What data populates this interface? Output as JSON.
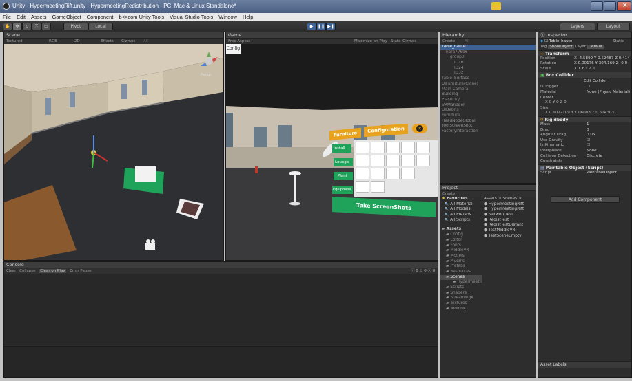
{
  "window": {
    "title": "Unity - HypermeetingRift.unity - HypermeetingRedistribution - PC, Mac & Linux Standalone*"
  },
  "menu": [
    "File",
    "Edit",
    "Assets",
    "GameObject",
    "Component",
    "b<>com Unity Tools",
    "Visual Studio Tools",
    "Window",
    "Help"
  ],
  "toolbar": {
    "pivot": "Pivot",
    "local": "Local",
    "layers": "Layers",
    "layout": "Layout"
  },
  "scene": {
    "tab": "Scene",
    "mode": "Textured",
    "color": "RGB",
    "dim": "2D",
    "effects": "Effects",
    "gizmos": "Gizmos",
    "search": "All",
    "persp": "Persp"
  },
  "game": {
    "tab": "Game",
    "aspect": "Free Aspect",
    "maximize": "Maximize on Play",
    "stats": "Stats",
    "gizmos": "Gizmos",
    "config_btn": "Config"
  },
  "vr_menu": {
    "header_left": "Furniture",
    "header_config": "Configuration",
    "categories": [
      "Install",
      "Lounge",
      "Plant",
      "Equipment"
    ],
    "screenshot_btn": "Take ScreenShots"
  },
  "hierarchy": {
    "tab": "Hierarchy",
    "create": "Create",
    "search": "All",
    "items": [
      {
        "label": "Table_haute",
        "indent": 0,
        "selected": true
      },
      {
        "label": "hara77696",
        "indent": 1
      },
      {
        "label": "group0",
        "indent": 2
      },
      {
        "label": "ID16",
        "indent": 3
      },
      {
        "label": "ID24",
        "indent": 3
      },
      {
        "label": "ID32",
        "indent": 3
      },
      {
        "label": "Table_Surface",
        "indent": 0
      },
      {
        "label": "UIFurniture(Clone)",
        "indent": 0
      },
      {
        "label": "Main Camera",
        "indent": 0
      },
      {
        "label": "Building",
        "indent": 0
      },
      {
        "label": "Plasticity",
        "indent": 0
      },
      {
        "label": "VRManager",
        "indent": 0
      },
      {
        "label": "UIDebris",
        "indent": 0
      },
      {
        "label": "Furniture",
        "indent": 0
      },
      {
        "label": "HeadNodeGlobal",
        "indent": 0
      },
      {
        "label": "ToolScreenShot",
        "indent": 0
      },
      {
        "label": "FactoryInteraction",
        "indent": 0
      }
    ]
  },
  "inspector": {
    "tab": "Inspector",
    "object_name": "Table_haute",
    "static": "Static",
    "tag_label": "Tag",
    "tag": "ShowObject",
    "layer_label": "Layer",
    "layer": "Default",
    "transform": {
      "title": "Transform",
      "position_label": "Position",
      "position": "X -4.5899  Y 0.52487  Z 0.414",
      "rotation_label": "Rotation",
      "rotation": "X 0.00176  Y 304.169  Z -0.0",
      "scale_label": "Scale",
      "scale": "X 1        Y 1        Z 1"
    },
    "box_collider": {
      "title": "Box Collider",
      "edit": "Edit Collider",
      "is_trigger_label": "Is Trigger",
      "material_label": "Material",
      "material": "None (Physic Material)",
      "center_label": "Center",
      "center": "X 0         Y 0         Z 0",
      "size_label": "Size",
      "size": "X 0.6072109  Y 1.06083  Z 0.614303"
    },
    "rigidbody": {
      "title": "Rigidbody",
      "mass_label": "Mass",
      "mass": "1",
      "drag_label": "Drag",
      "drag": "0",
      "angular_drag_label": "Angular Drag",
      "angular_drag": "0.05",
      "use_gravity_label": "Use Gravity",
      "is_kinematic_label": "Is Kinematic",
      "interpolate_label": "Interpolate",
      "interpolate": "None",
      "collision_label": "Collision Detection",
      "collision": "Discrete",
      "constraints_label": "Constraints"
    },
    "paintable": {
      "title": "Paintable Object (Script)",
      "script_label": "Script",
      "script": "PaintableObject"
    },
    "add_component": "Add Component",
    "asset_labels": "Asset Labels"
  },
  "project": {
    "tab": "Project",
    "create": "Create",
    "favorites_header": "Favorites",
    "favorites": [
      "All Material",
      "All Models",
      "All Prefabs",
      "All Scripts"
    ],
    "assets_header": "Assets",
    "folders": [
      "Config",
      "Editor",
      "Fonts",
      "MiddleVR",
      "Models",
      "Plugins",
      "Prefabs",
      "Resources",
      "Scenes",
      "Hypermeeting",
      "Scripts",
      "Shaders",
      "StreamingA",
      "Textures",
      "Toolbox"
    ],
    "breadcrumb": "Assets > Scenes >",
    "files": [
      "HypermeetingRift",
      "HypermeetingRift",
      "NetworkTest",
      "RedistTest",
      "RedistTestDistant",
      "TestMiddleVR",
      "TestSceneEmpty"
    ]
  },
  "console": {
    "tab": "Console",
    "buttons": [
      "Clear",
      "Collapse",
      "Clear on Play",
      "Error Pause"
    ],
    "counts": [
      "0",
      "0",
      "0"
    ]
  },
  "colors": {
    "accent": "#3d6194",
    "panel": "#2d2d2d",
    "green": "#1fa35a",
    "orange": "#e8a21d"
  }
}
